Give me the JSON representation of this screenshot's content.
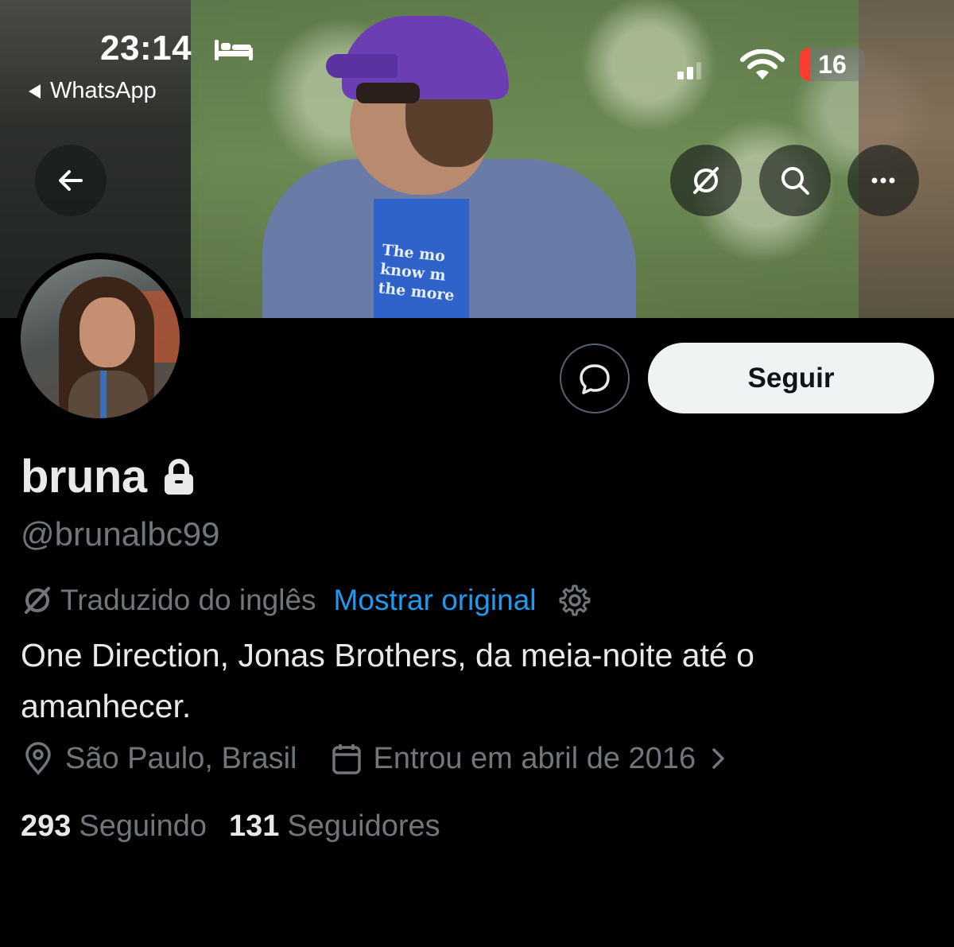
{
  "status_bar": {
    "time": "23:14",
    "back_app": "WhatsApp",
    "battery_level": "16",
    "battery_fraction": 0.16,
    "icons": [
      "bed-icon",
      "signal-icon",
      "wifi-icon",
      "battery-icon"
    ]
  },
  "banner": {
    "shirt_text": "The mo know m the more"
  },
  "nav": {
    "back_icon": "back-arrow-icon",
    "translate_icon": "translate-off-icon",
    "search_icon": "search-icon",
    "more_icon": "more-icon"
  },
  "actions": {
    "message_icon": "message-icon",
    "follow_label": "Seguir"
  },
  "profile": {
    "name": "bruna",
    "protected_icon": "lock-icon",
    "handle": "@brunalbc99",
    "translated_label": "Traduzido do inglês",
    "show_original_label": "Mostrar original",
    "bio": "One Direction, Jonas Brothers, da meia-noite até o amanhecer.",
    "location": "São Paulo, Brasil",
    "joined": "Entrou em abril de 2016"
  },
  "stats": {
    "following_count": "293",
    "following_label": "Seguindo",
    "followers_count": "131",
    "followers_label": "Seguidores"
  },
  "colors": {
    "background": "#000000",
    "link": "#1d9bf0",
    "muted": "#71767b",
    "text": "#e7e9ea",
    "button_bg": "#eff3f4",
    "battery_low": "#ff3b30"
  }
}
